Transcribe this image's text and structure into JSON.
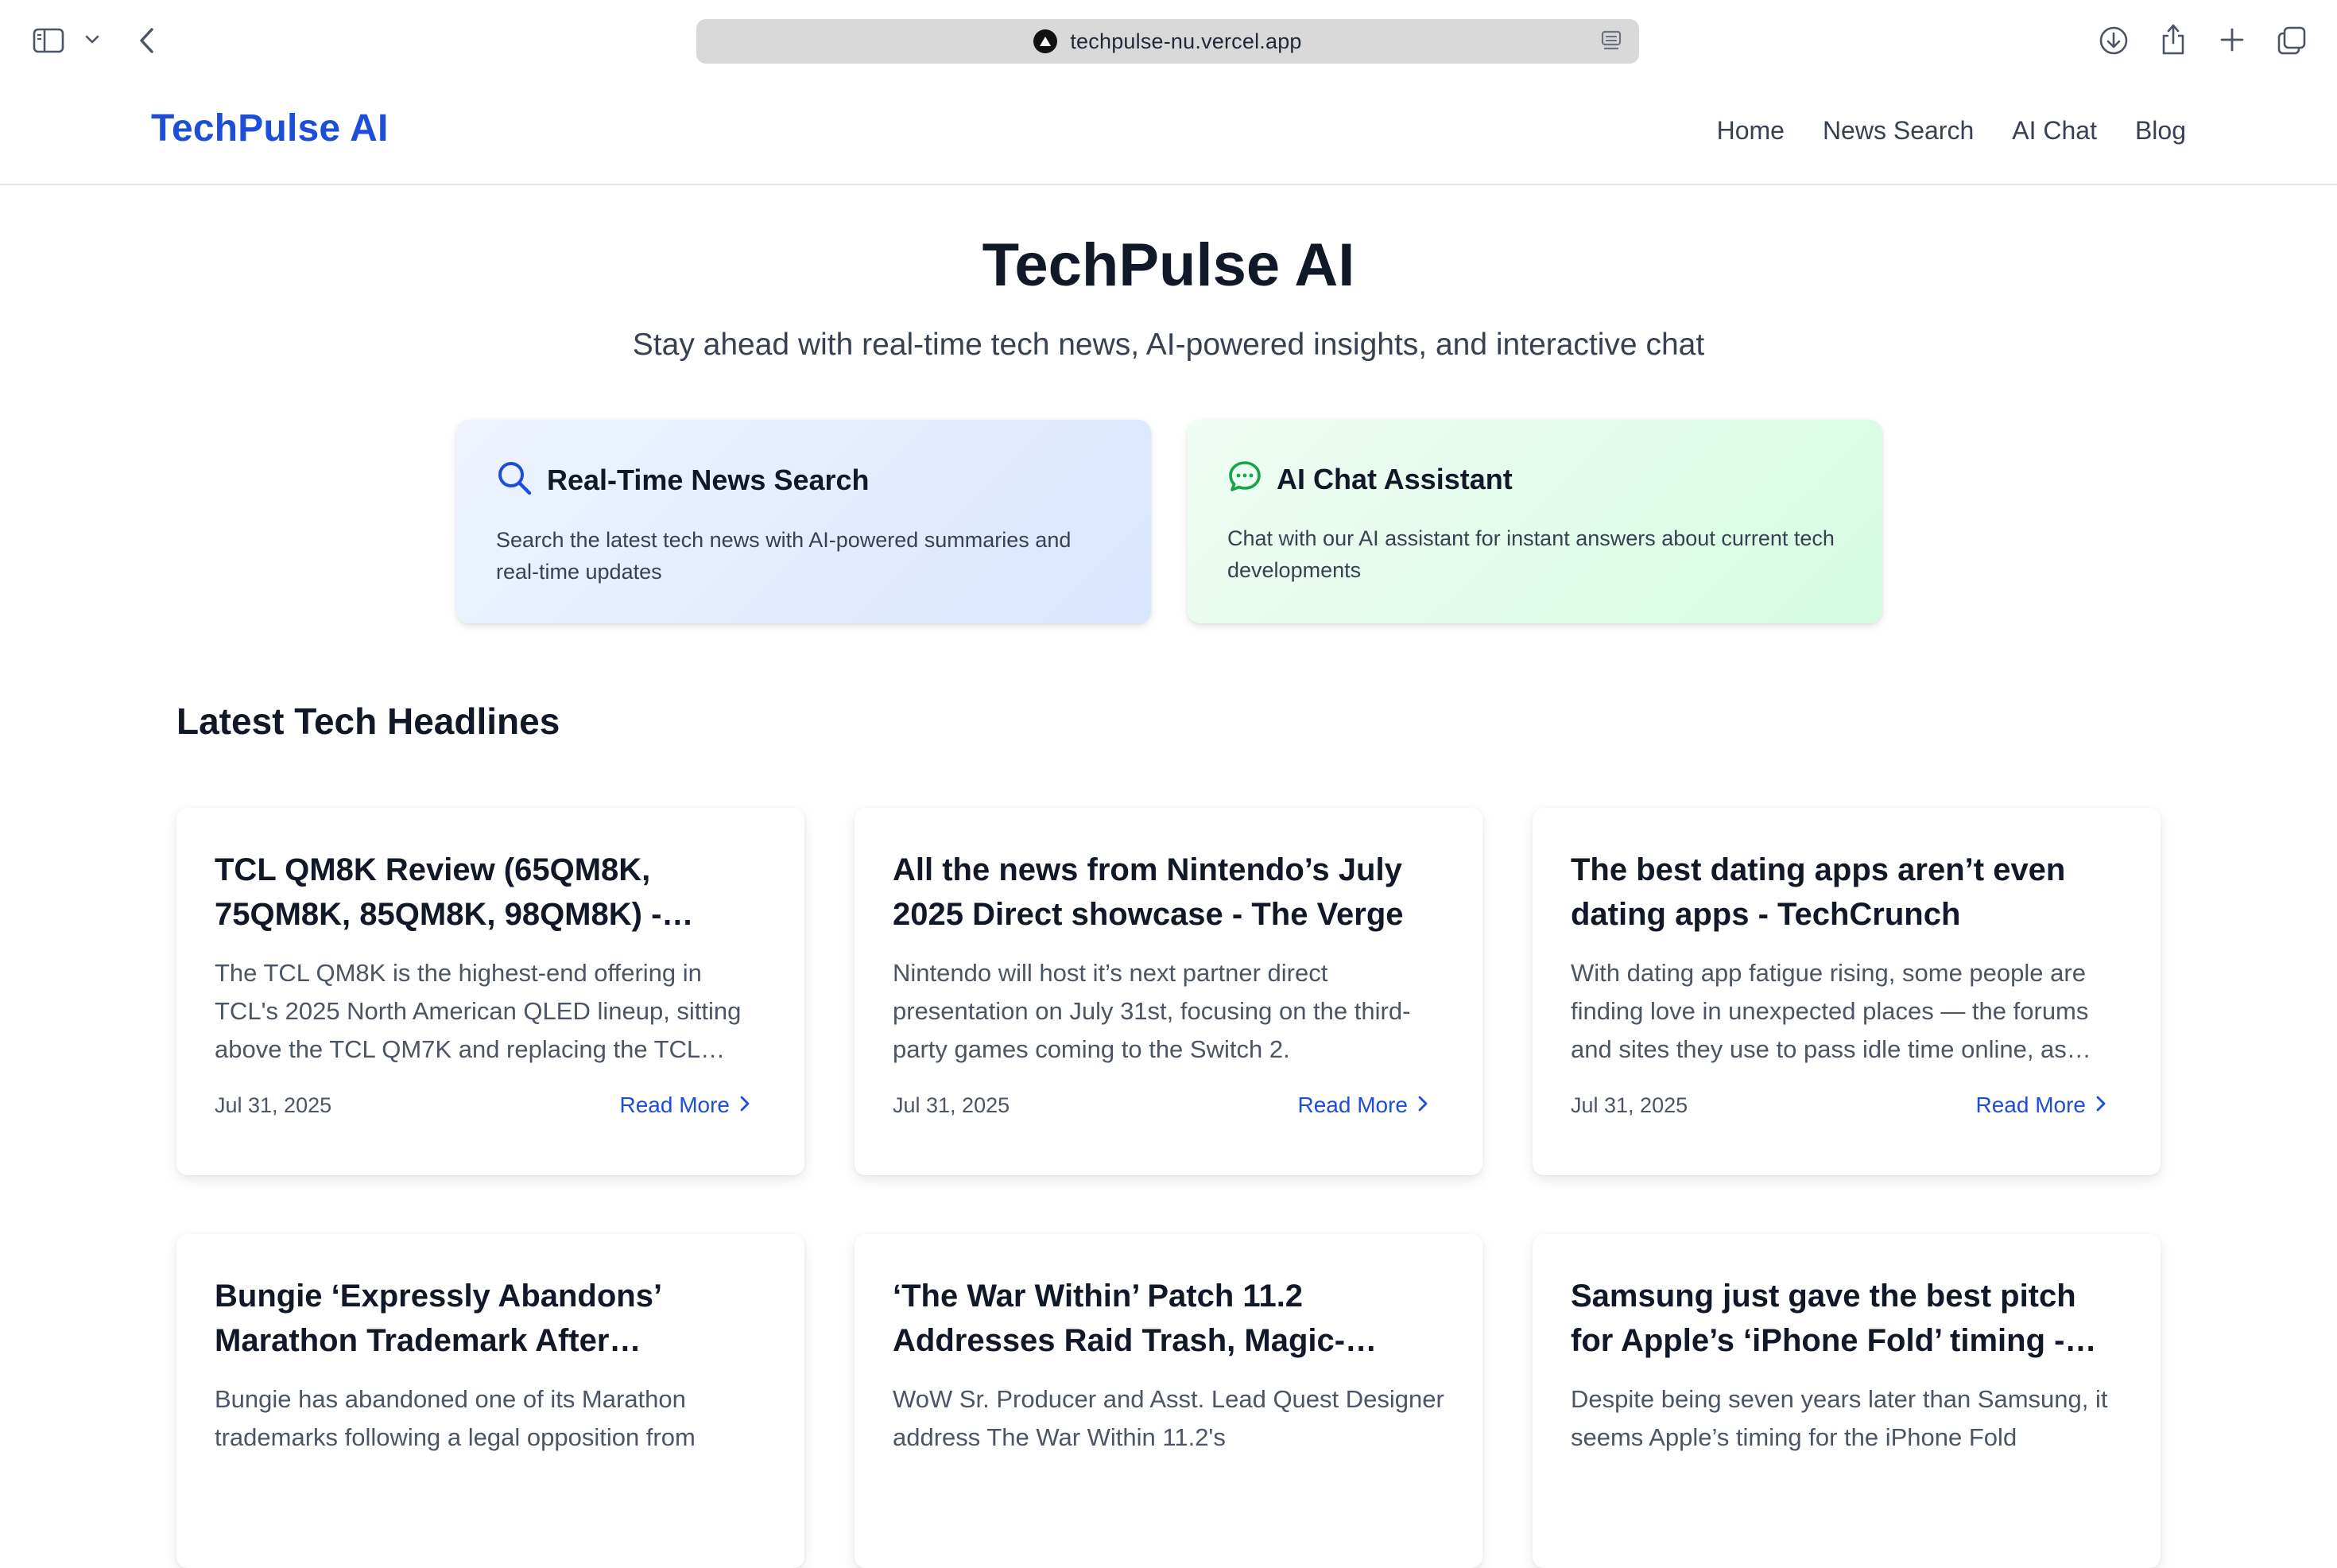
{
  "browser": {
    "url": "techpulse-nu.vercel.app",
    "icons": [
      "sidebar-icon",
      "chevron-down-icon",
      "back-icon",
      "vercel-icon",
      "reader-icon",
      "download-icon",
      "share-icon",
      "plus-icon",
      "tabs-icon"
    ]
  },
  "header": {
    "brand": "TechPulse AI",
    "nav": [
      "Home",
      "News Search",
      "AI Chat",
      "Blog"
    ]
  },
  "hero": {
    "title": "TechPulse AI",
    "subtitle": "Stay ahead with real-time tech news, AI-powered insights, and interactive chat"
  },
  "features": [
    {
      "icon": "search-icon",
      "title": "Real-Time News Search",
      "description": "Search the latest tech news with AI-powered summaries and real-time updates"
    },
    {
      "icon": "chat-icon",
      "title": "AI Chat Assistant",
      "description": "Chat with our AI assistant for instant answers about current tech developments"
    }
  ],
  "headlines": {
    "section_title": "Latest Tech Headlines",
    "read_more": "Read More",
    "articles": [
      {
        "title": "TCL QM8K Review (65QM8K, 75QM8K, 85QM8K, 98QM8K) -…",
        "description": "The TCL QM8K is the highest-end offering in TCL's 2025 North American QLED lineup, sitting above the TCL QM7K and replacing the TCL…",
        "date": "Jul 31, 2025"
      },
      {
        "title": "All the news from Nintendo’s July 2025 Direct showcase - The Verge",
        "description": "Nintendo will host it’s next partner direct presentation on July 31st, focusing on the third-party games coming to the Switch 2.",
        "date": "Jul 31, 2025"
      },
      {
        "title": "The best dating apps aren’t even dating apps - TechCrunch",
        "description": "With dating app fatigue rising, some people are finding love in unexpected places — the forums and sites they use to pass idle time online, as…",
        "date": "Jul 31, 2025"
      },
      {
        "title": "Bungie ‘Expressly Abandons’ Marathon Trademark After…",
        "description": "Bungie has abandoned one of its Marathon trademarks following a legal opposition from",
        "date": ""
      },
      {
        "title": "‘The War Within’ Patch 11.2 Addresses Raid Trash, Magic-…",
        "description": "WoW Sr. Producer and Asst. Lead Quest Designer address The War Within 11.2's",
        "date": ""
      },
      {
        "title": "Samsung just gave the best pitch for Apple’s ‘iPhone Fold’ timing -…",
        "description": "Despite being seven years later than Samsung, it seems Apple’s timing for the iPhone Fold",
        "date": ""
      }
    ]
  },
  "colors": {
    "brand": "#1d4ed8",
    "search_icon": "#1d4ed8",
    "chat_icon": "#16a34a"
  }
}
